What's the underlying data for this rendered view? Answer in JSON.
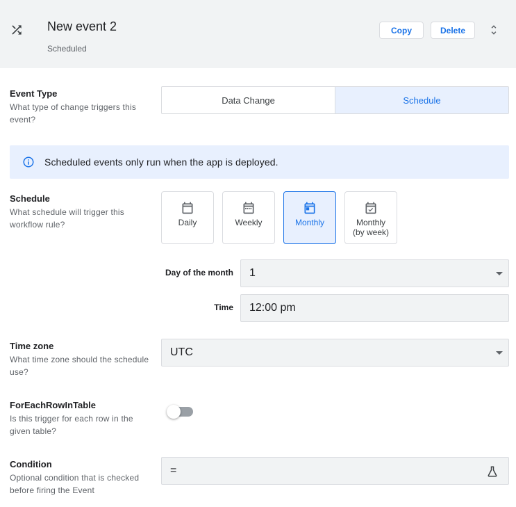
{
  "header": {
    "icon": "shuffle-icon",
    "title": "New event 2",
    "subtitle": "Scheduled",
    "copy_label": "Copy",
    "delete_label": "Delete",
    "expand_icon": "unfold-icon"
  },
  "event_type": {
    "title": "Event Type",
    "description": "What type of change triggers this event?",
    "options": [
      "Data Change",
      "Schedule"
    ],
    "selected": "Schedule"
  },
  "banner": {
    "icon": "info-icon",
    "text": "Scheduled events only run when the app is deployed."
  },
  "schedule": {
    "title": "Schedule",
    "description": "What schedule will trigger this workflow rule?",
    "options": [
      {
        "label": "Daily",
        "icon": "calendar-icon"
      },
      {
        "label": "Weekly",
        "icon": "calendar-week-icon"
      },
      {
        "label": "Monthly",
        "icon": "calendar-month-icon"
      },
      {
        "label": "Monthly\n(by week)",
        "icon": "calendar-check-icon"
      }
    ],
    "selected": "Monthly",
    "day_of_month_label": "Day of the month",
    "day_of_month_value": "1",
    "time_label": "Time",
    "time_value": "12:00 pm"
  },
  "timezone": {
    "title": "Time zone",
    "description": "What time zone should the schedule use?",
    "value": "UTC"
  },
  "for_each": {
    "title": "ForEachRowInTable",
    "description": "Is this trigger for each row in the given table?",
    "enabled": false
  },
  "condition": {
    "title": "Condition",
    "description": "Optional condition that is checked before firing the Event",
    "value": "=",
    "icon": "flask-icon"
  },
  "colors": {
    "accent": "#1a73e8",
    "active_bg": "#e8f0fe",
    "header_bg": "#f1f3f4"
  }
}
